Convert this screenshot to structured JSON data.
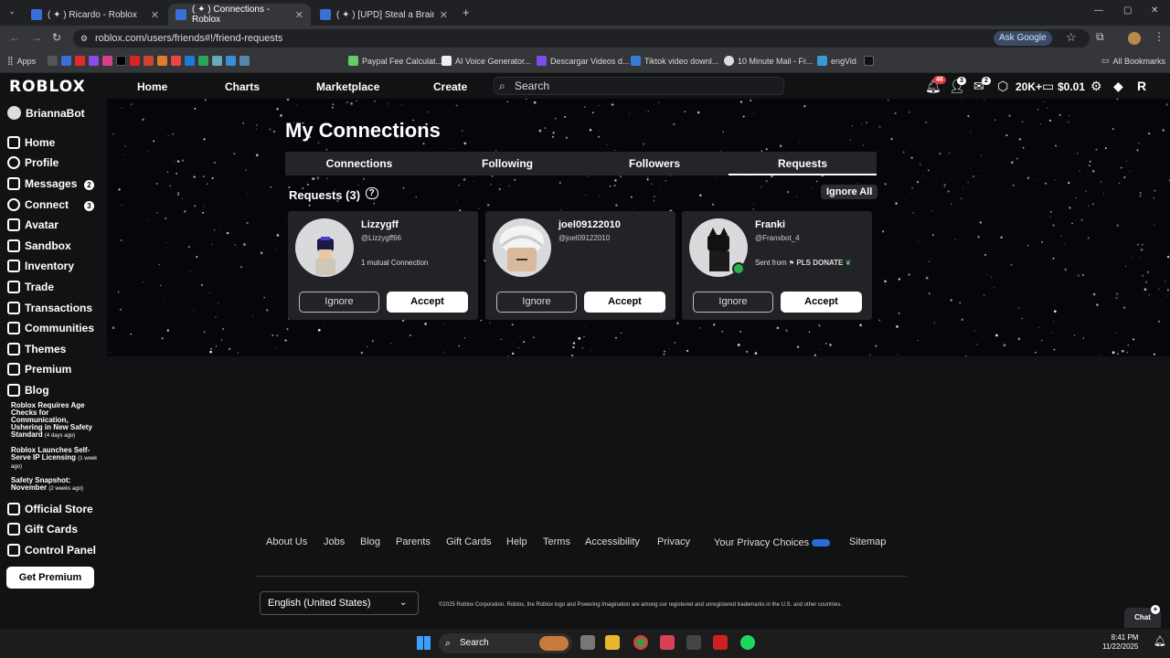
{
  "browser": {
    "tabs": [
      {
        "title": "( ✦ ) Ricardo - Roblox",
        "active": false
      },
      {
        "title": "( ✦ ) Connections - Roblox",
        "active": true
      },
      {
        "title": "( ✦ ) [UPD] Steal a Brainrot - Ro",
        "active": false
      }
    ],
    "url": "roblox.com/users/friends#!/friend-requests",
    "ask_google": "Ask Google",
    "bookmarks": [
      "Apps",
      "Paypal Fee Calculat...",
      "AI Voice Generator...",
      "Descargar Videos d...",
      "Tiktok video downl...",
      "10 Minute Mail - Fr...",
      "engVid",
      "All Bookmarks"
    ]
  },
  "header": {
    "logo": "ROBLOX",
    "nav": [
      "Home",
      "Charts",
      "Marketplace",
      "Create"
    ],
    "search_placeholder": "Search",
    "notifications_badge": "46",
    "friends_badge": "3",
    "messages_badge": "2",
    "robux": "20K+",
    "balance": "$0.01"
  },
  "sidebar": {
    "username": "BriannaBot",
    "items": [
      "Home",
      "Profile",
      "Messages",
      "Connect",
      "Avatar",
      "Sandbox",
      "Inventory",
      "Trade",
      "Transactions",
      "Communities",
      "Themes",
      "Premium",
      "Blog"
    ],
    "messages_badge": "2",
    "connect_badge": "3",
    "blog_posts": [
      {
        "title": "Roblox Requires Age Checks for Communication, Ushering in New Safety Standard",
        "ago": "(4 days ago)"
      },
      {
        "title": "Roblox Launches Self-Serve IP Licensing",
        "ago": "(1 week ago)"
      },
      {
        "title": "Safety Snapshot: November",
        "ago": "(2 weeks ago)"
      }
    ],
    "bottom_items": [
      "Official Store",
      "Gift Cards",
      "Control Panel"
    ],
    "get_premium": "Get Premium"
  },
  "main": {
    "title": "My Connections",
    "tabs": [
      "Connections",
      "Following",
      "Followers",
      "Requests"
    ],
    "selected_tab": "Requests",
    "requests_title": "Requests (3)",
    "ignore_all": "Ignore All",
    "cards": [
      {
        "name": "Lizzygff",
        "handle": "@Lizzygff66",
        "info": "1 mutual Connection",
        "ignore": "Ignore",
        "accept": "Accept"
      },
      {
        "name": "joel09122010",
        "handle": "@joel09122010",
        "info": "",
        "ignore": "Ignore",
        "accept": "Accept"
      },
      {
        "name": "Franki",
        "handle": "@Franxbot_4",
        "info": "Sent from ",
        "info_bold": "PLS DONATE",
        "ignore": "Ignore",
        "accept": "Accept"
      }
    ]
  },
  "footer": {
    "links": [
      "About Us",
      "Jobs",
      "Blog",
      "Parents",
      "Gift Cards",
      "Help",
      "Terms",
      "Accessibility",
      "Privacy",
      "Your Privacy Choices",
      "Sitemap"
    ],
    "language": "English (United States)",
    "copyright": "©2025 Roblox Corporation. Roblox, the Roblox logo and Powering Imagination are among our registered and unregistered trademarks in the U.S. and other countries.",
    "chat": "Chat"
  },
  "taskbar": {
    "search": "Search",
    "time": "8:41 PM",
    "date": "11/22/2025"
  }
}
